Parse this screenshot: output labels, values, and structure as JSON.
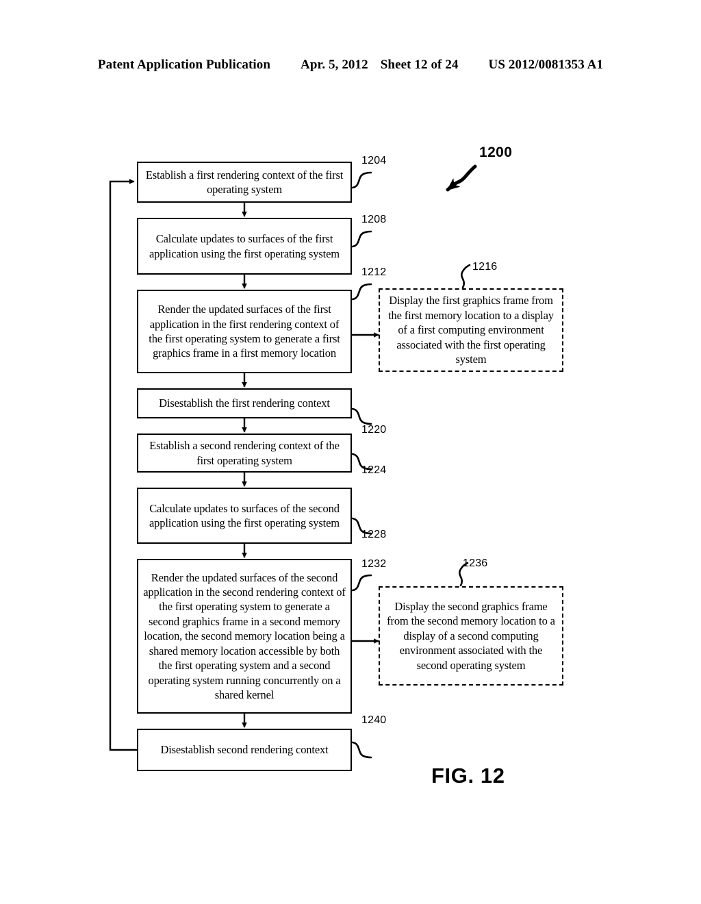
{
  "header": {
    "publication": "Patent Application Publication",
    "date": "Apr. 5, 2012",
    "sheet": "Sheet 12 of 24",
    "patent_number": "US 2012/0081353 A1"
  },
  "figure": {
    "caption": "FIG. 12",
    "figure_ref": "1200",
    "nodes": [
      {
        "ref": "1204",
        "style": "solid",
        "text": "Establish a first rendering context of the first operating system"
      },
      {
        "ref": "1208",
        "style": "solid",
        "text": "Calculate updates to surfaces of the first application using the first operating system"
      },
      {
        "ref": "1212",
        "style": "solid",
        "text": "Render the updated surfaces of the first application in the first rendering context of the first operating system to generate a first graphics frame in a first memory location"
      },
      {
        "ref": "1216",
        "style": "dashed",
        "text": "Display the first graphics frame from the first memory location to a display of a first computing environment associated with the first operating system"
      },
      {
        "ref": "1220",
        "style": "solid",
        "text": "Disestablish the first rendering context"
      },
      {
        "ref": "1224",
        "style": "solid",
        "text": "Establish a second rendering context of the first operating system"
      },
      {
        "ref": "1228",
        "style": "solid",
        "text": "Calculate updates to surfaces of the second application using the first operating system"
      },
      {
        "ref": "1232",
        "style": "solid",
        "text": "Render the updated surfaces of the second application in the second rendering context of the first operating system to generate a second graphics frame in a second memory location, the second memory location being a shared memory location accessible by both the first operating system and a second operating system running concurrently on a shared kernel"
      },
      {
        "ref": "1236",
        "style": "dashed",
        "text": "Display the second graphics frame from the second memory location to a display of a second computing environment associated with the second operating system"
      },
      {
        "ref": "1240",
        "style": "solid",
        "text": "Disestablish second rendering context"
      }
    ]
  }
}
